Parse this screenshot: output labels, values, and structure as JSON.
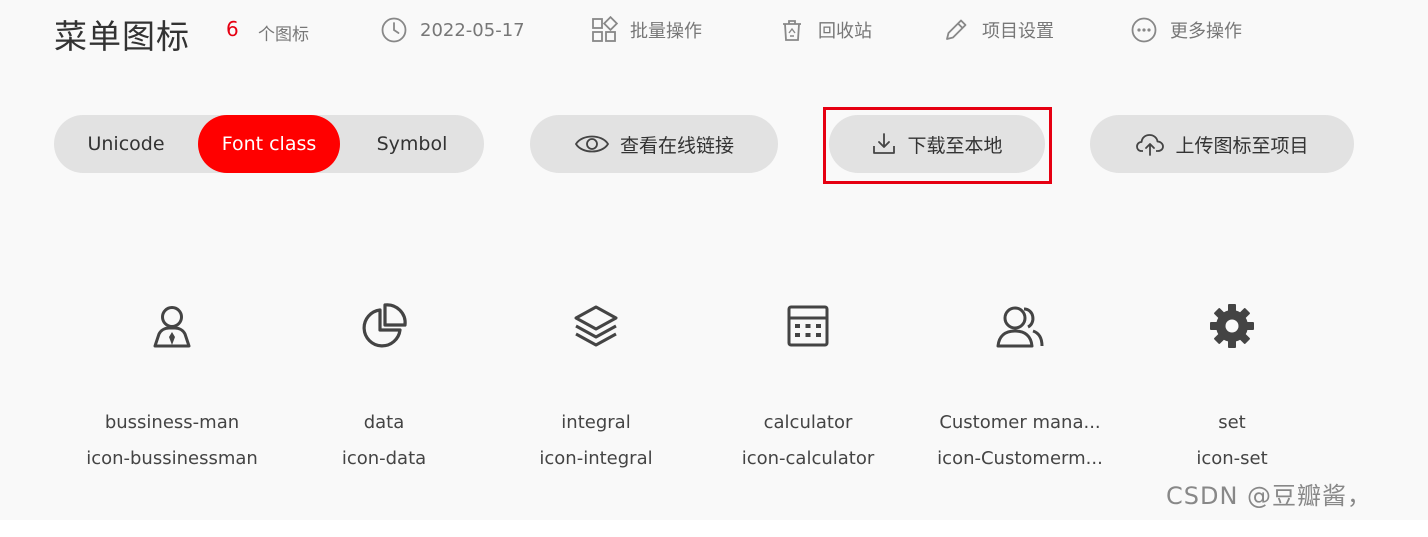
{
  "header": {
    "title": "菜单图标",
    "count": "6",
    "count_label": "个图标",
    "date": "2022-05-17",
    "actions": [
      {
        "label": "批量操作",
        "icon": "batch-grid-icon"
      },
      {
        "label": "回收站",
        "icon": "trash-icon"
      },
      {
        "label": "项目设置",
        "icon": "pencil-icon"
      },
      {
        "label": "更多操作",
        "icon": "more-dots-icon"
      }
    ]
  },
  "toolbar": {
    "tabs": [
      "Unicode",
      "Font class",
      "Symbol"
    ],
    "active_tab": "Font class",
    "view_link_label": "查看在线链接",
    "download_label": "下载至本地",
    "upload_label": "上传图标至项目"
  },
  "icons": [
    {
      "name": "bussiness-man",
      "class": "icon-bussinessman",
      "icon": "businessman-icon"
    },
    {
      "name": "data",
      "class": "icon-data",
      "icon": "pie-chart-icon"
    },
    {
      "name": "integral",
      "class": "icon-integral",
      "icon": "layers-icon"
    },
    {
      "name": "calculator",
      "class": "icon-calculator",
      "icon": "calculator-icon"
    },
    {
      "name": "Customer mana...",
      "class": "icon-Customerm...",
      "icon": "customers-icon"
    },
    {
      "name": "set",
      "class": "icon-set",
      "icon": "gear-icon"
    }
  ],
  "watermark": "CSDN @豆瓣酱，",
  "colors": {
    "accent": "#ff0000",
    "pill_bg": "#e2e2e2",
    "highlight_border": "#e60012"
  }
}
